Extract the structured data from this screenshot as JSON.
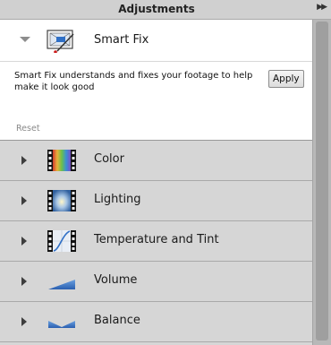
{
  "panel": {
    "title": "Adjustments",
    "collapse_icon": "double-chevron-right-icon"
  },
  "smart_fix": {
    "label": "Smart Fix",
    "description": "Smart Fix understands and fixes your footage to help make it look good",
    "apply_label": "Apply",
    "reset_label": "Reset",
    "expanded": true
  },
  "sections": [
    {
      "label": "Color",
      "icon": "color-filmstrip-icon"
    },
    {
      "label": "Lighting",
      "icon": "lighting-filmstrip-icon"
    },
    {
      "label": "Temperature and Tint",
      "icon": "temperature-curve-icon"
    },
    {
      "label": "Volume",
      "icon": "volume-wedge-icon"
    },
    {
      "label": "Balance",
      "icon": "balance-icon"
    }
  ],
  "colors": {
    "panel_bg": "#d6d6d6",
    "expanded_bg": "#ffffff",
    "icon_blue": "#2f6fc6"
  }
}
